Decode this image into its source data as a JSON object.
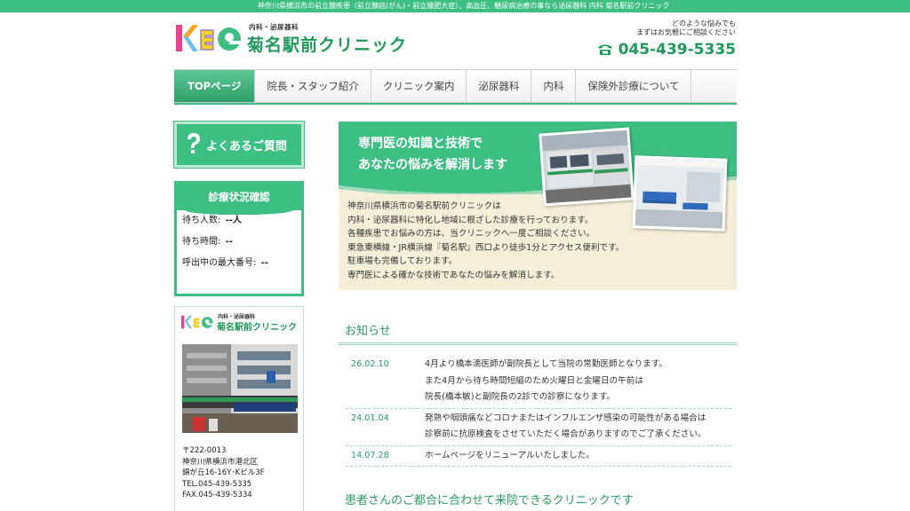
{
  "topbar": {
    "text": "神奈川県横浜市の前立腺疾患（前立腺癌(がん)・前立腺肥大症）、高血圧、糖尿病治療の事なら泌尿器科 内科 菊名駅前クリニック"
  },
  "header": {
    "logo_sub": "内科・泌尿器科",
    "logo_title": "菊名駅前クリニック",
    "note_line1": "どのような悩みでも",
    "note_line2": "まずはお気軽にご相談ください",
    "tel": "045-439-5335"
  },
  "nav": {
    "items": [
      {
        "label": "TOPページ"
      },
      {
        "label": "院長・スタッフ紹介"
      },
      {
        "label": "クリニック案内"
      },
      {
        "label": "泌尿器科"
      },
      {
        "label": "内科"
      },
      {
        "label": "保険外診療について"
      }
    ]
  },
  "sidebar": {
    "faq_label": "よくあるご質問",
    "status": {
      "title": "診療状況確認",
      "rows": [
        {
          "label": "待ち人数:",
          "value": "--人"
        },
        {
          "label": "待ち時間:",
          "value": "--"
        },
        {
          "label": "呼出中の最大番号:",
          "value": "--"
        }
      ]
    },
    "info": {
      "logo_sub": "内科・泌尿器科",
      "logo_title": "菊名駅前クリニック",
      "address_lines": [
        "〒222-0013",
        "神奈川県横浜市港北区",
        "錦が丘16-16Y･Kビル3F",
        "TEL.045-439-5335",
        "FAX.045-439-5334"
      ]
    }
  },
  "hero": {
    "title_line1": "専門医の知識と技術で",
    "title_line2": "あなたの悩みを解消します",
    "paragraphs": [
      "神奈川県横浜市の菊名駅前クリニックは",
      "内科・泌尿器科に特化し地域に根ざした診療を行っております。",
      "各種疾患でお悩みの方は、当クリニックへ一度ご相談ください。",
      "東急東横線・JR横浜線『菊名駅』西口より徒歩1分とアクセス便利です。",
      "駐車場も完備しております。",
      "専門医による確かな技術であなたの悩みを解消します。"
    ]
  },
  "news": {
    "title": "お知らせ",
    "items": [
      {
        "date": "26.02.10",
        "lines": [
          "4月より橋本滴医師が副院長として当院の常勤医師となります。",
          "また4月から待ち時間短縮のため火曜日と金曜日の午前は",
          "院長(橋本敏)と副院長の2診での診察になります。"
        ]
      },
      {
        "date": "24.01.04",
        "lines": [
          "発熱や咽頭痛などコロナまたはインフルエンザ感染の可能性がある場合は",
          "診察前に抗原検査をさせていただく場合がありますのでご了承ください。"
        ]
      },
      {
        "date": "14.07.28",
        "lines": [
          "ホームページをリニューアルいたしました。"
        ]
      }
    ]
  },
  "section2": {
    "title": "患者さんのご都合に合わせて来院できるクリニックです"
  },
  "colors": {
    "brand_green": "#3dbf83",
    "dark_green": "#1e9a5a",
    "hero_bg": "#f5efd9"
  },
  "icons": {
    "phone": "phone-icon",
    "faq": "question-icon",
    "logo": "kee-logo-icon"
  }
}
